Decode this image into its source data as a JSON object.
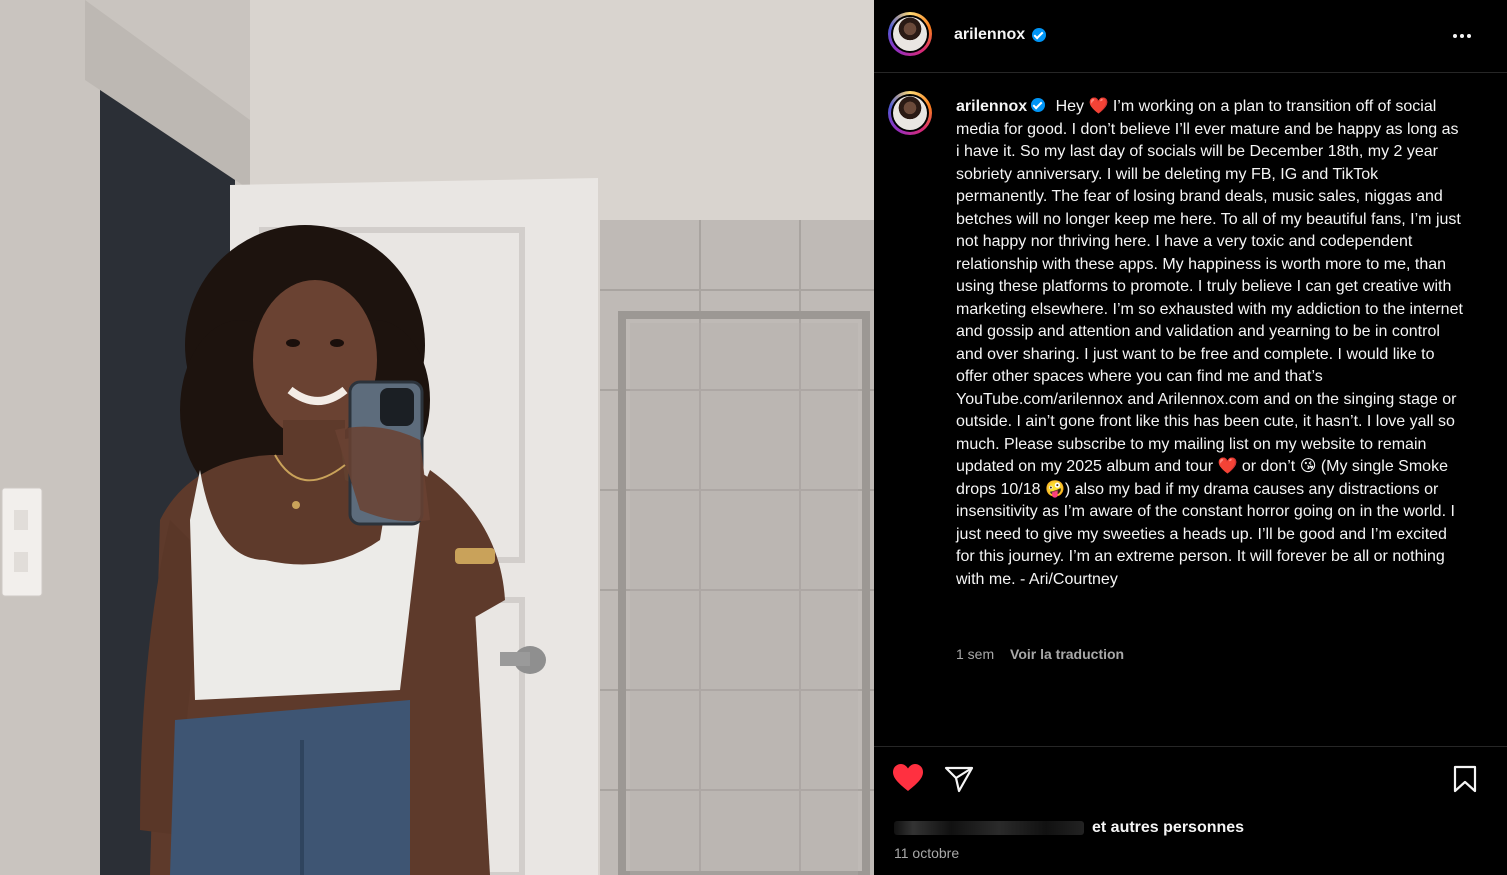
{
  "post": {
    "author": "arilennox",
    "caption": "Hey ❤️ I’m working on a plan to transition off of social media for good. I don’t believe I’ll ever mature and be happy as long as i have it. So my last day of socials will be December 18th, my 2 year sobriety anniversary. I will be deleting my FB, IG and TikTok permanently. The fear of losing brand deals, music sales, niggas and betches will no longer keep me here. To all of my beautiful fans, I’m just not happy nor thriving here. I have a very toxic and codependent relationship with these apps. My happiness is worth more to me, than using these platforms to promote. I truly believe I can get creative with marketing elsewhere. I’m so exhausted with my addiction to the internet and gossip and attention and validation and yearning to be in control and over sharing. I just want to be free and complete. I would like to offer other spaces where you can find me and that’s YouTube.com/arilennox and Arilennox.com and on the singing stage or outside. I ain’t gone front like this has been cute, it hasn’t. I love yall so much. Please subscribe to my mailing list on my website to remain updated on my 2025 album and tour ❤️ or don’t 😘 (My single Smoke drops 10/18 🤪) also my bad if my drama causes any distractions or insensitivity as I’m aware of the constant horror going on in the world. I just need to give my sweeties a heads up. I’ll be good and I’m excited for this journey. I’m an extreme person. It will forever be all or nothing with me. - Ari/Courtney",
    "time_ago": "1 sem",
    "translate_label": "Voir la traduction",
    "likes_suffix": "et autres personnes",
    "date": "11 octobre"
  },
  "icons": {
    "more": "more-options-icon",
    "like": "heart-filled-icon",
    "share": "share-icon",
    "save": "bookmark-icon",
    "verified": "verified-badge-icon"
  },
  "colors": {
    "like_red": "#ff3040",
    "verified_blue": "#0095f6",
    "muted_text": "#a8a8a8"
  }
}
